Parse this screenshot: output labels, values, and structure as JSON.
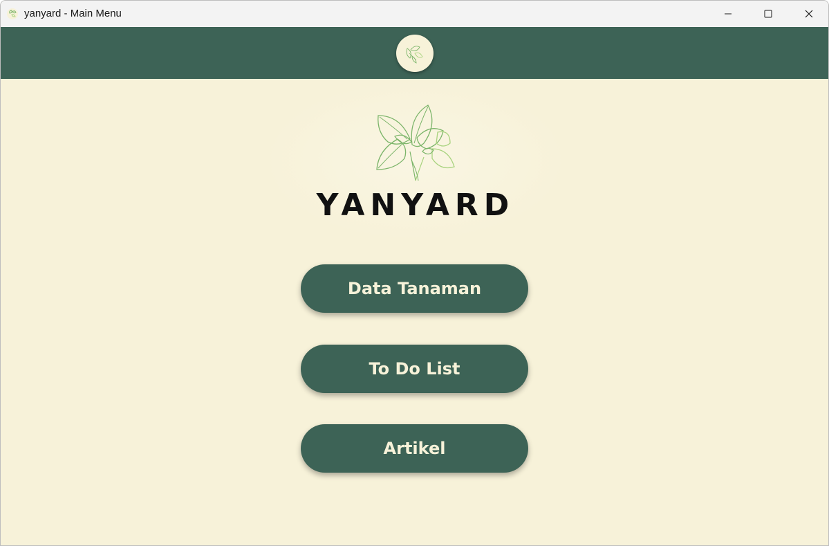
{
  "window": {
    "title": "yanyard - Main Menu",
    "controls": [
      "minimize",
      "maximize",
      "close"
    ]
  },
  "header": {
    "logo_icon": "plant-leaves-icon"
  },
  "hero": {
    "logo_icon": "plant-leaves-icon",
    "brand_name": "YANYARD"
  },
  "menu": {
    "items": [
      {
        "label": "Data Tanaman"
      },
      {
        "label": "To Do List"
      },
      {
        "label": "Artikel"
      }
    ]
  },
  "colors": {
    "primary_green": "#3d6356",
    "cream_background": "#f7f2d9",
    "leaf_green": "#7cb56a",
    "light_leaf_green": "#a9d37f",
    "text_dark": "#111111"
  }
}
